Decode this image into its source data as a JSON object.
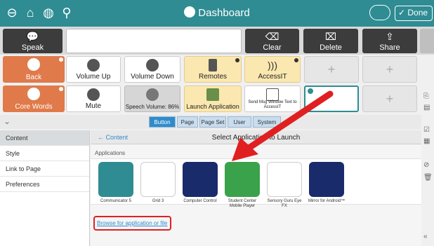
{
  "topbar": {
    "title": "Dashboard",
    "done_label": "Done",
    "icons": [
      "back-circle-icon",
      "home-icon",
      "globe-icon",
      "search-icon",
      "cloud-sync-icon"
    ]
  },
  "message_bar": {
    "speak": "Speak",
    "clear": "Clear",
    "delete": "Delete",
    "share": "Share"
  },
  "grid": {
    "row1": [
      "Back",
      "Volume Up",
      "Volume Down",
      "Remotes",
      "AccessIT"
    ],
    "row2": [
      "Core Words",
      "Mute",
      "Speech Volume: 86%",
      "Launch Application",
      "Send Msg Window Text to AccessIT"
    ]
  },
  "tabs": [
    "Button",
    "Page",
    "Page Set",
    "User",
    "System"
  ],
  "left_menu": [
    "Content",
    "Style",
    "Link to Page",
    "Preferences"
  ],
  "panel": {
    "back_link": "Content",
    "title": "Select Application to Launch",
    "applications_label": "Applications",
    "browse_link": "Browse for application or file"
  },
  "apps": [
    {
      "name": "Communicator 5",
      "color": "#2f8c93"
    },
    {
      "name": "Grid 3",
      "color": "#ffffff"
    },
    {
      "name": "Computer Control",
      "color": "#1a2b6b"
    },
    {
      "name": "Student Center Mobile Player",
      "color": "#3aa24a"
    },
    {
      "name": "Sensory Guru Eye FX",
      "color": "#ffffff"
    },
    {
      "name": "Mirror for Android™",
      "color": "#1a2b6b"
    }
  ],
  "colors": {
    "teal": "#2f8c93",
    "orange": "#e07a4a",
    "yellow": "#fbe8b0",
    "accent_blue": "#2f8ccc",
    "highlight_red": "#e02020"
  }
}
